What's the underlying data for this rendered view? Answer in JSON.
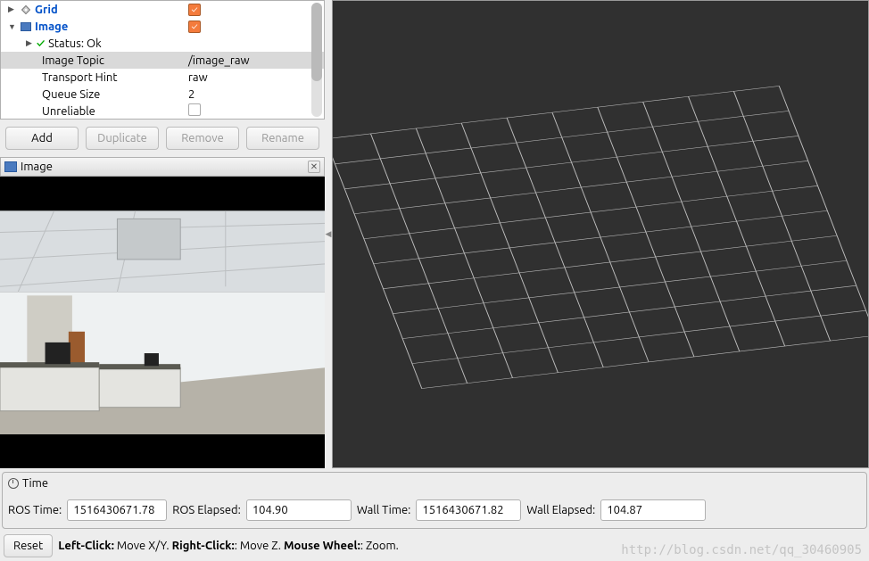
{
  "tree": {
    "grid": {
      "label": "Grid",
      "checked": true
    },
    "image": {
      "label": "Image",
      "checked": true,
      "status_label": "Status: Ok",
      "topic_label": "Image Topic",
      "topic_value": "/image_raw",
      "transport_label": "Transport Hint",
      "transport_value": "raw",
      "queue_label": "Queue Size",
      "queue_value": "2",
      "unreliable_label": "Unreliable"
    }
  },
  "buttons": {
    "add": "Add",
    "duplicate": "Duplicate",
    "remove": "Remove",
    "rename": "Rename"
  },
  "image_panel": {
    "title": "Image"
  },
  "time": {
    "panel_title": "Time",
    "ros_time_label": "ROS Time:",
    "ros_time_value": "1516430671.78",
    "ros_elapsed_label": "ROS Elapsed:",
    "ros_elapsed_value": "104.90",
    "wall_time_label": "Wall Time:",
    "wall_time_value": "1516430671.82",
    "wall_elapsed_label": "Wall Elapsed:",
    "wall_elapsed_value": "104.87"
  },
  "status": {
    "reset": "Reset",
    "hint_left_b": "Left-Click:",
    "hint_left_t": " Move X/Y. ",
    "hint_right_b": "Right-Click:",
    "hint_right_t": ": Move Z. ",
    "hint_wheel_b": "Mouse Wheel:",
    "hint_wheel_t": ": Zoom."
  },
  "watermark": "http://blog.csdn.net/qq_30460905"
}
